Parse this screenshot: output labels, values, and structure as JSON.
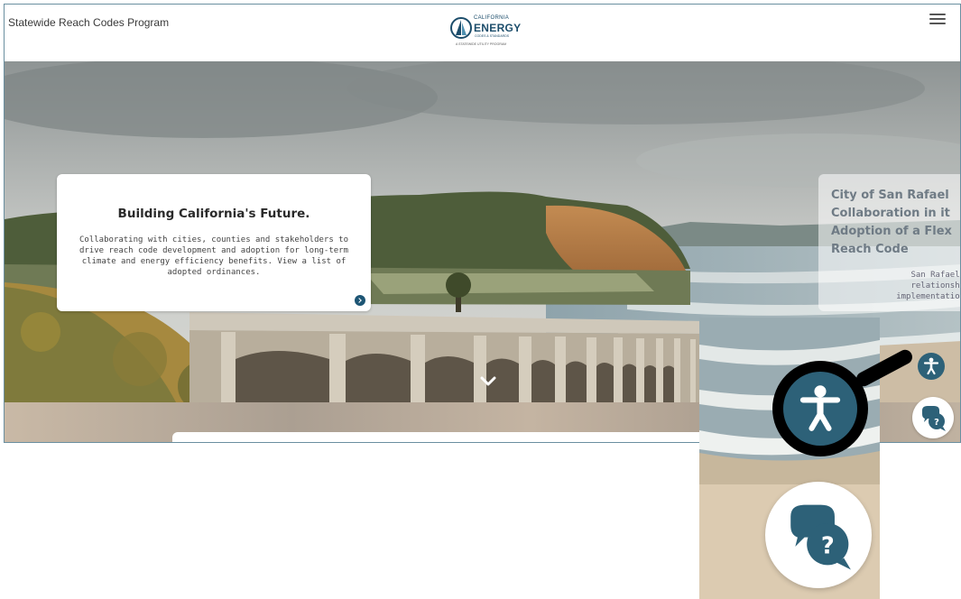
{
  "header": {
    "site_name": "Statewide Reach Codes Program",
    "logo": {
      "top": "CALIFORNIA",
      "main": "ENERGY",
      "sub": "CODES & STANDARDS",
      "tag": "A STATEWIDE UTILITY PROGRAM"
    },
    "menu_icon": "hamburger-icon"
  },
  "hero": {
    "card": {
      "title": "Building California's Future.",
      "body": "Collaborating with cities, counties and stakeholders to drive reach code development and adoption for long-term climate and energy efficiency benefits. View a list of adopted ordinances.",
      "arrow_icon": "chevron-right-circle-icon"
    },
    "card2": {
      "title": "City of San Rafael\nCollaboration in it\nAdoption of a Flex\nReach Code",
      "body": "San Rafael combine\nrelationships with\nimplementation in dev"
    },
    "scroll_icon": "chevron-down-icon"
  },
  "widgets": {
    "accessibility_icon": "accessibility-person-icon",
    "help_icon": "help-chat-bubbles-icon",
    "accent": "#2d6178"
  }
}
